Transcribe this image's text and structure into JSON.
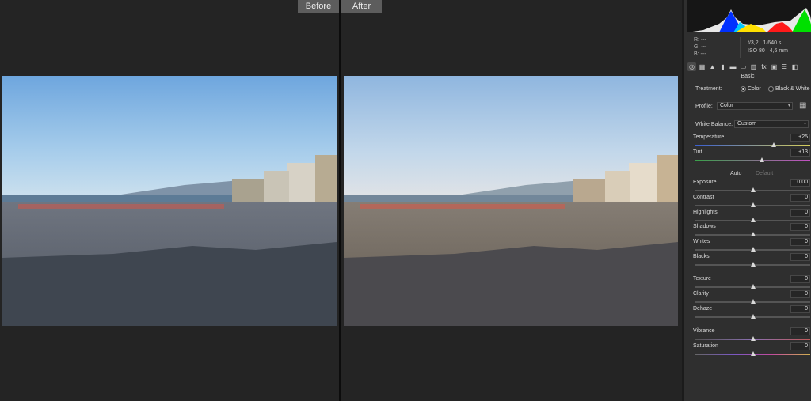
{
  "compare": {
    "before_label": "Before",
    "after_label": "After"
  },
  "photo": {
    "alt_before": "beach photo before edit",
    "alt_after": "beach photo after edit"
  },
  "meta": {
    "rgb": [
      "R:   ---",
      "G:   ---",
      "B:   ---"
    ],
    "aperture": "f/3,2",
    "shutter": "1/640 s",
    "iso": "ISO 80",
    "focal": "4,6 mm"
  },
  "tools": [
    {
      "icon": "basic-icon",
      "glyph": "◎"
    },
    {
      "icon": "tone-curve-icon",
      "glyph": "▦"
    },
    {
      "icon": "detail-icon",
      "glyph": "▲"
    },
    {
      "icon": "hsl-icon",
      "glyph": "▮"
    },
    {
      "icon": "split-tone-icon",
      "glyph": "▬"
    },
    {
      "icon": "lens-icon",
      "glyph": "▭"
    },
    {
      "icon": "transform-icon",
      "glyph": "▥"
    },
    {
      "icon": "effects-icon",
      "glyph": "fx"
    },
    {
      "icon": "calibration-icon",
      "glyph": "▣"
    },
    {
      "icon": "presets-icon",
      "glyph": "☰"
    },
    {
      "icon": "snapshots-icon",
      "glyph": "◧"
    }
  ],
  "panel": {
    "section": "Basic",
    "treatment_label": "Treatment:",
    "treatment_color": "Color",
    "treatment_bw": "Black & White",
    "profile_label": "Profile:",
    "profile_value": "Color",
    "wb_label": "White Balance:",
    "wb_value": "Custom",
    "auto_label": "Auto",
    "default_label": "Default"
  },
  "sliders": [
    {
      "name": "Temperature",
      "value": "+25",
      "pos": 0.68
    },
    {
      "name": "Tint",
      "value": "+13",
      "pos": 0.58
    },
    {
      "name": "Exposure",
      "value": "0,00",
      "pos": 0.5
    },
    {
      "name": "Contrast",
      "value": "0",
      "pos": 0.5
    },
    {
      "name": "Highlights",
      "value": "0",
      "pos": 0.5
    },
    {
      "name": "Shadows",
      "value": "0",
      "pos": 0.5
    },
    {
      "name": "Whites",
      "value": "0",
      "pos": 0.5
    },
    {
      "name": "Blacks",
      "value": "0",
      "pos": 0.5
    },
    {
      "name": "Texture",
      "value": "0",
      "pos": 0.5
    },
    {
      "name": "Clarity",
      "value": "0",
      "pos": 0.5
    },
    {
      "name": "Dehaze",
      "value": "0",
      "pos": 0.5
    },
    {
      "name": "Vibrance",
      "value": "0",
      "pos": 0.5
    },
    {
      "name": "Saturation",
      "value": "0",
      "pos": 0.5
    }
  ]
}
